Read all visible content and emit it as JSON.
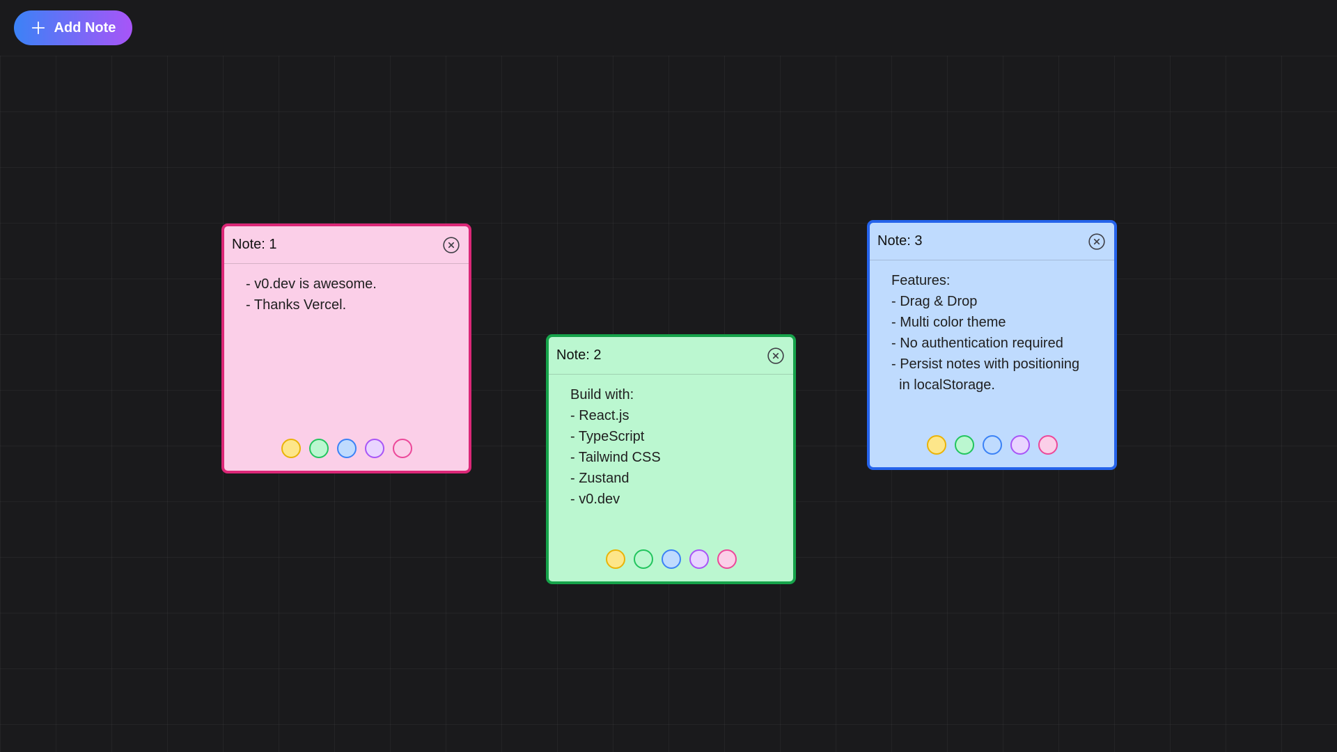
{
  "toolbar": {
    "add_note_label": "Add Note",
    "add_icon": "plus-icon",
    "gradient_from": "#3b82f6",
    "gradient_to": "#a855f7"
  },
  "notes": [
    {
      "title": "Note: 1",
      "color": "pink",
      "body": "- v0.dev is awesome.\n- Thanks Vercel.",
      "close_icon": "close-circle-icon"
    },
    {
      "title": "Note: 2",
      "color": "green",
      "body": "Build with:\n- React.js\n- TypeScript\n- Tailwind CSS\n- Zustand\n- v0.dev",
      "close_icon": "close-circle-icon"
    },
    {
      "title": "Note: 3",
      "color": "blue",
      "body": "Features:\n- Drag & Drop\n- Multi color theme\n- No authentication required\n- Persist notes with positioning\n  in localStorage.",
      "close_icon": "close-circle-icon"
    }
  ],
  "color_options": [
    "yellow",
    "green",
    "blue",
    "purple",
    "pink"
  ],
  "colors": {
    "background": "#1a1a1c",
    "pink_fill": "#fbcfe8",
    "pink_border": "#db2777",
    "green_fill": "#bbf7d0",
    "green_border": "#16a34a",
    "blue_fill": "#bfdbfe",
    "blue_border": "#2563eb"
  }
}
